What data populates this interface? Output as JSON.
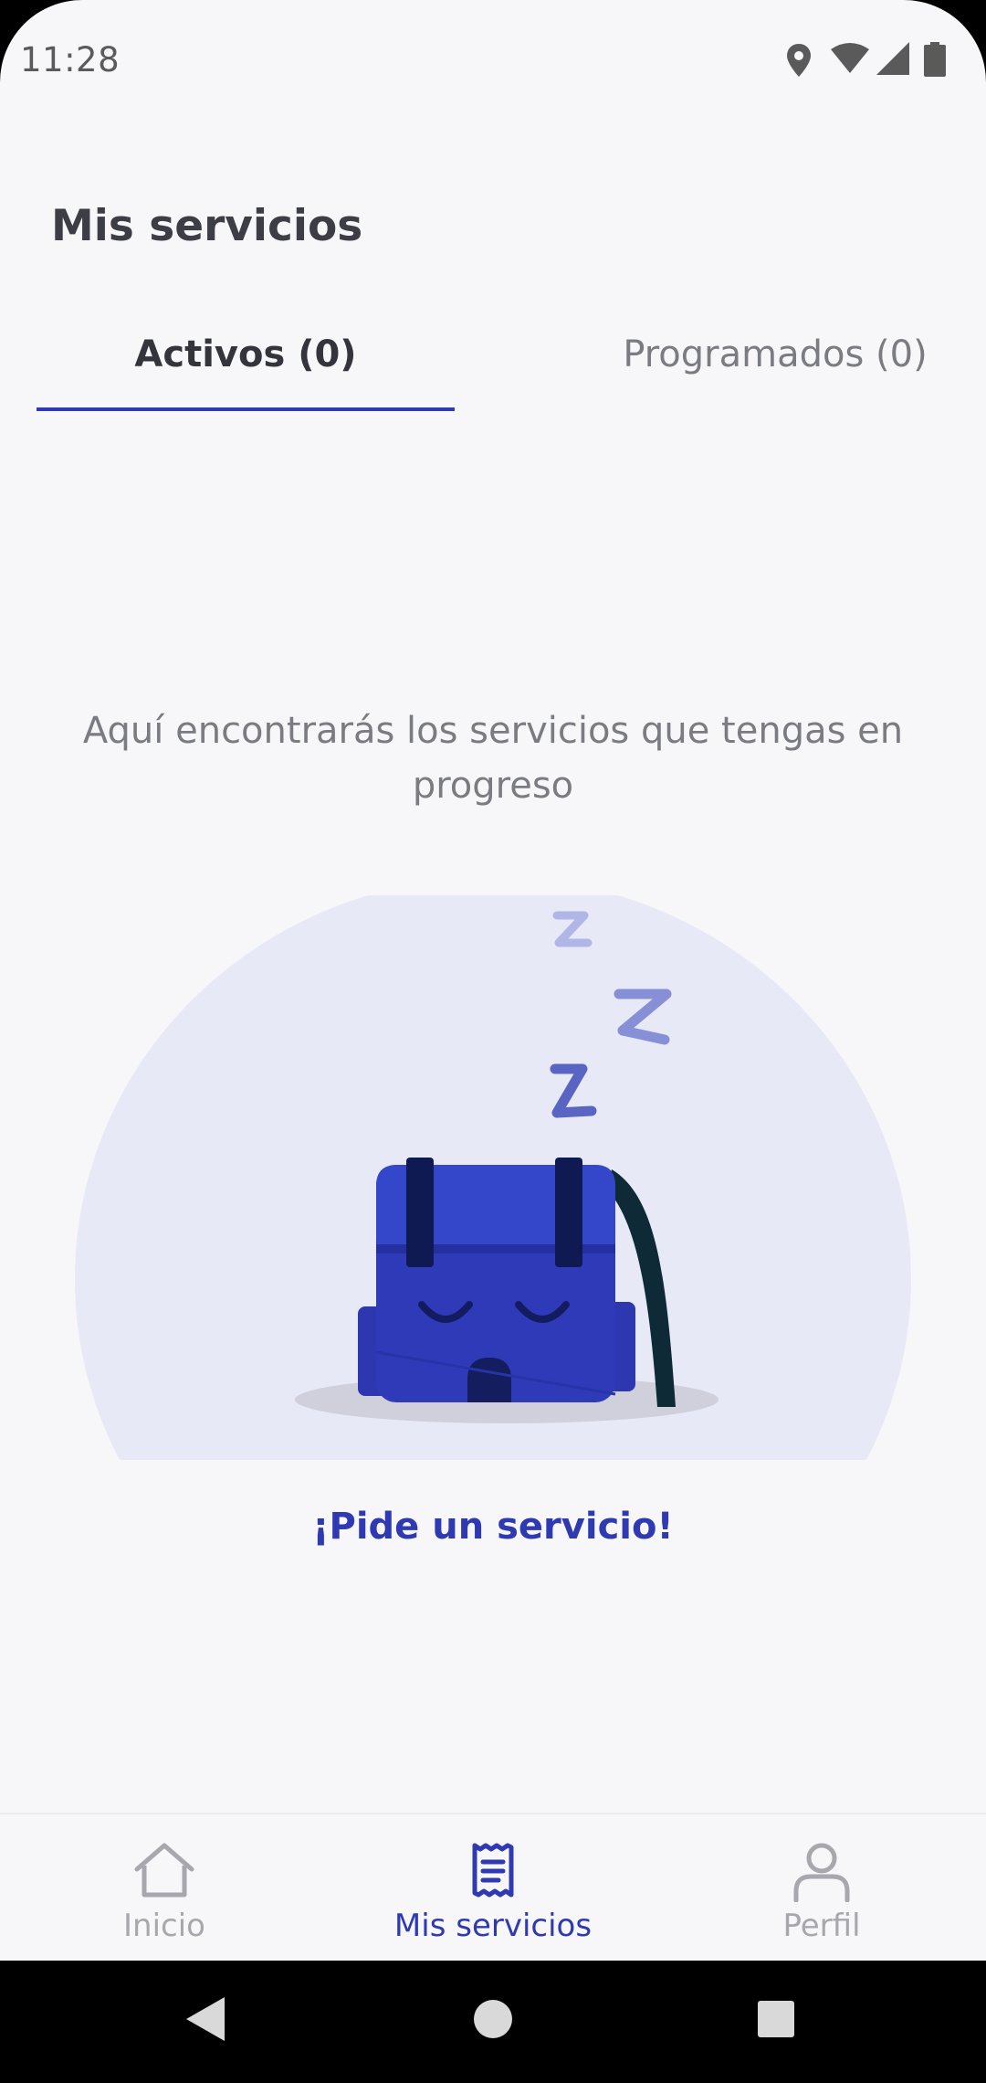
{
  "status_bar": {
    "time": "11:28",
    "icons": [
      "location-icon",
      "wifi-icon",
      "signal-icon",
      "battery-icon"
    ]
  },
  "page": {
    "title": "Mis servicios"
  },
  "tabs": [
    {
      "label": "Activos (0)",
      "active": true
    },
    {
      "label": "Programados (0)",
      "active": false
    }
  ],
  "empty_state": {
    "message": "Aquí encontrarás los servicios que tengas en progreso",
    "cta_label": "¡Pide un servicio!"
  },
  "bottom_nav": {
    "items": [
      {
        "label": "Inicio",
        "icon": "home-icon",
        "active": false
      },
      {
        "label": "Mis servicios",
        "icon": "receipt-icon",
        "active": true
      },
      {
        "label": "Perfil",
        "icon": "person-icon",
        "active": false
      }
    ]
  },
  "system_nav": {
    "buttons": [
      "back-icon",
      "home-circle-icon",
      "recents-icon"
    ]
  },
  "colors": {
    "accent": "#2f3ab2",
    "background": "#f7f7f9",
    "text_primary": "#3d3d45",
    "text_secondary": "#7b7b82",
    "inactive_nav": "#a7a7ad"
  }
}
